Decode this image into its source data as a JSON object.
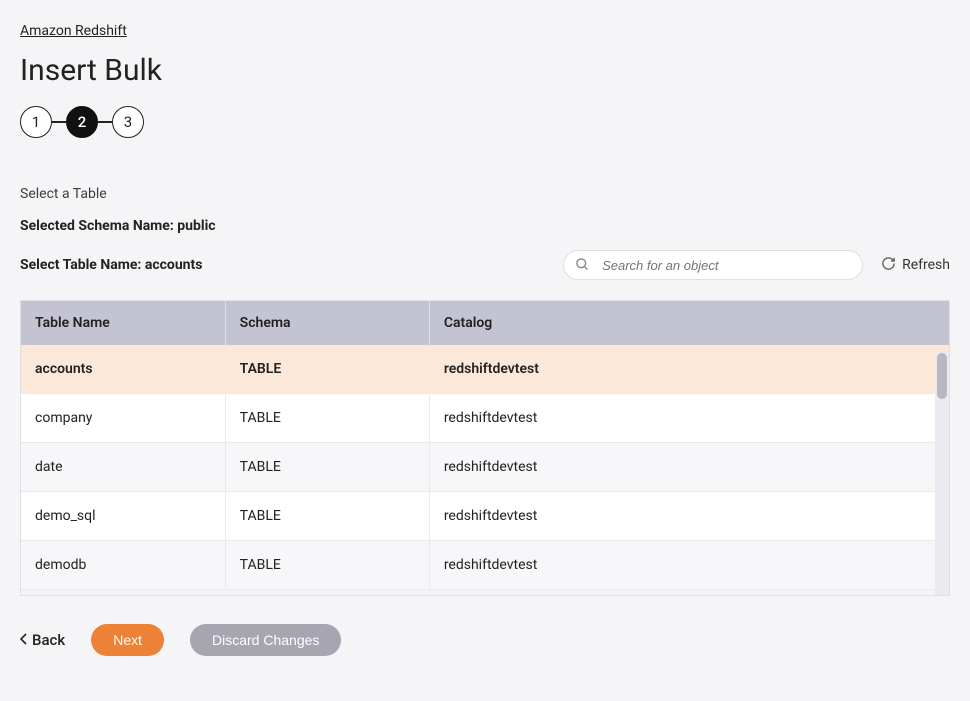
{
  "breadcrumb": {
    "label": "Amazon Redshift"
  },
  "page": {
    "title": "Insert Bulk"
  },
  "stepper": {
    "steps": [
      "1",
      "2",
      "3"
    ],
    "activeIndex": 1
  },
  "prompt": {
    "label": "Select a Table"
  },
  "schema": {
    "label": "Selected Schema Name: public"
  },
  "tableSel": {
    "label": "Select Table Name: accounts"
  },
  "search": {
    "placeholder": "Search for an object"
  },
  "refresh": {
    "label": "Refresh"
  },
  "table": {
    "headers": {
      "name": "Table Name",
      "schema": "Schema",
      "catalog": "Catalog"
    },
    "rows": [
      {
        "name": "accounts",
        "schema": "TABLE",
        "catalog": "redshiftdevtest",
        "selected": true
      },
      {
        "name": "company",
        "schema": "TABLE",
        "catalog": "redshiftdevtest",
        "selected": false
      },
      {
        "name": "date",
        "schema": "TABLE",
        "catalog": "redshiftdevtest",
        "selected": false
      },
      {
        "name": "demo_sql",
        "schema": "TABLE",
        "catalog": "redshiftdevtest",
        "selected": false
      },
      {
        "name": "demodb",
        "schema": "TABLE",
        "catalog": "redshiftdevtest",
        "selected": false
      }
    ]
  },
  "footer": {
    "back": "Back",
    "next": "Next",
    "discard": "Discard Changes"
  }
}
